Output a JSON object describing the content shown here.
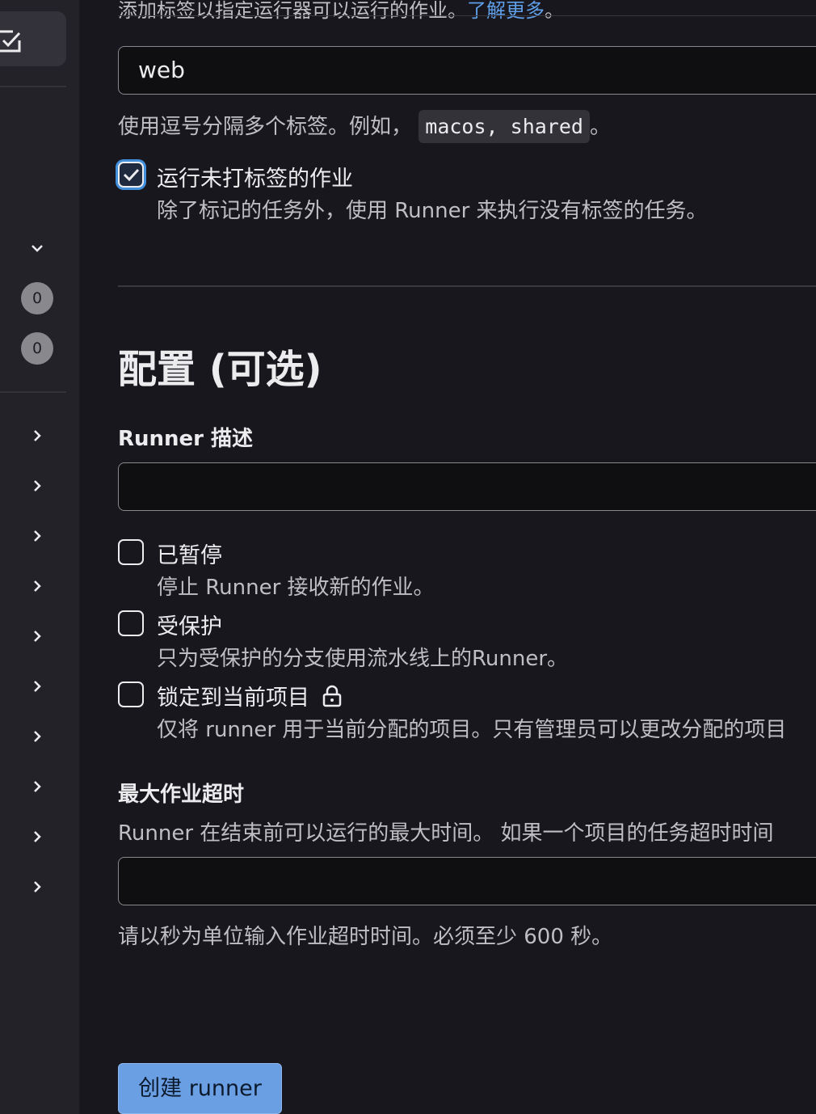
{
  "sidebar": {
    "badges": [
      "0",
      "0"
    ]
  },
  "tags": {
    "top_hint": "添加标签以指定运行器可以运行的作业。",
    "top_hint_link": "了解更多",
    "top_hint_end": "。",
    "input_value": "web",
    "help_text": "使用逗号分隔多个标签。例如，",
    "help_example": "macos, shared",
    "help_end": "。"
  },
  "untagged": {
    "label": "运行未打标签的作业",
    "help": "除了标记的任务外，使用 Runner 来执行没有标签的任务。",
    "checked": true
  },
  "config": {
    "title": "配置 (可选)",
    "description_label": "Runner 描述",
    "description_value": "",
    "options": [
      {
        "label": "已暂停",
        "help": "停止 Runner 接收新的作业。",
        "checked": false
      },
      {
        "label": "受保护",
        "help": "只为受保护的分支使用流水线上的Runner。",
        "checked": false
      },
      {
        "label": "锁定到当前项目",
        "help": "仅将 runner 用于当前分配的项目。只有管理员可以更改分配的项目",
        "checked": false
      }
    ],
    "timeout_label": "最大作业超时",
    "timeout_desc": "Runner 在结束前可以运行的最大时间。 如果一个项目的任务超时时间",
    "timeout_value": "",
    "timeout_help": "请以秒为单位输入作业超时时间。必须至少 600 秒。"
  },
  "submit_label": "创建 runner"
}
